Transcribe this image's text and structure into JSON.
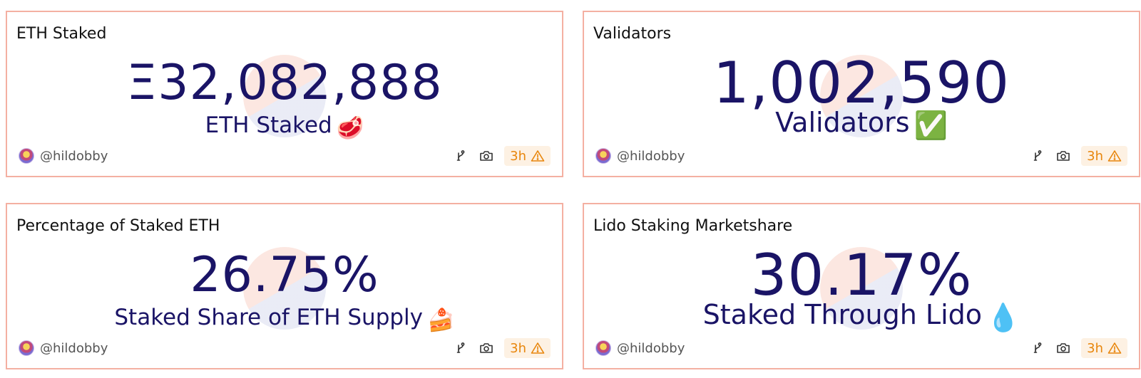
{
  "cards": [
    {
      "title": "ETH Staked",
      "value": "Ξ32,082,888",
      "label": "ETH Staked",
      "emoji": "🥩",
      "author": "@hildobby",
      "age": "3h"
    },
    {
      "title": "Validators",
      "value": "1,002,590",
      "label": "Validators",
      "emoji": "✅",
      "author": "@hildobby",
      "age": "3h"
    },
    {
      "title": "Percentage of Staked ETH",
      "value": "26.75%",
      "label": "Staked Share of ETH Supply",
      "emoji": "🍰",
      "author": "@hildobby",
      "age": "3h"
    },
    {
      "title": "Lido Staking Marketshare",
      "value": "30.17%",
      "label": "Staked Through Lido",
      "emoji": "💧",
      "author": "@hildobby",
      "age": "3h"
    }
  ],
  "icons": {
    "fork": "fork-icon",
    "snapshot": "camera-icon",
    "warning": "warning-icon"
  },
  "colors": {
    "border": "#f4b0a2",
    "counter": "#1a1466",
    "badge_text": "#e8860c",
    "badge_bg": "#fdf1e3"
  }
}
